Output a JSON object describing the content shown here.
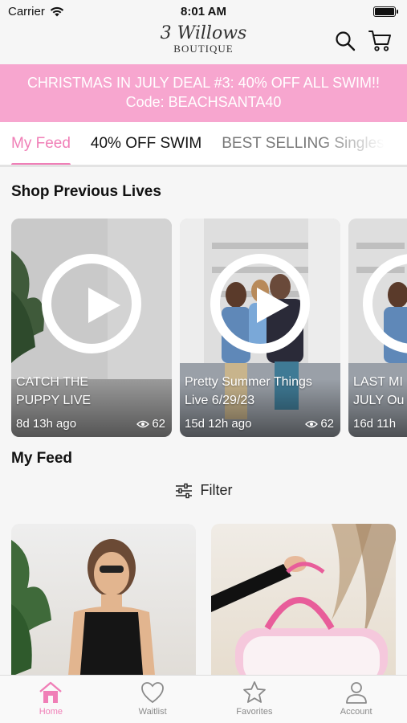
{
  "status_bar": {
    "carrier": "Carrier",
    "time": "8:01 AM"
  },
  "header": {
    "logo_line1": "3 Willows",
    "logo_line2": "BOUTIQUE",
    "icons": [
      "search-icon",
      "cart-icon"
    ]
  },
  "promo": {
    "line1": "CHRISTMAS IN JULY DEAL #3: 40% OFF ALL SWIM!!",
    "line2": "Code: BEACHSANTA40",
    "color": "#f7a6cf"
  },
  "tabs": [
    {
      "label": "My Feed",
      "active": true
    },
    {
      "label": "40% OFF SWIM"
    },
    {
      "label": "BEST SELLING Singles"
    }
  ],
  "lives_section": {
    "title": "Shop Previous Lives",
    "items": [
      {
        "title_line1": "CATCH THE",
        "title_line2": "PUPPY LIVE",
        "ago": "8d 13h ago",
        "views": "62"
      },
      {
        "title_line1": "Pretty Summer Things",
        "title_line2": "Live 6/29/23",
        "ago": "15d 12h ago",
        "views": "62"
      },
      {
        "title_line1": "LAST MI",
        "title_line2": "JULY Ou",
        "ago": "16d 11h",
        "views": ""
      }
    ]
  },
  "feed": {
    "title": "My Feed",
    "filter_label": "Filter"
  },
  "bottom_nav": [
    {
      "label": "Home",
      "icon": "home-icon",
      "active": true
    },
    {
      "label": "Waitlist",
      "icon": "heart-icon"
    },
    {
      "label": "Favorites",
      "icon": "star-icon"
    },
    {
      "label": "Account",
      "icon": "person-icon"
    }
  ],
  "colors": {
    "accent": "#f07fb7",
    "banner": "#f7a6cf"
  }
}
